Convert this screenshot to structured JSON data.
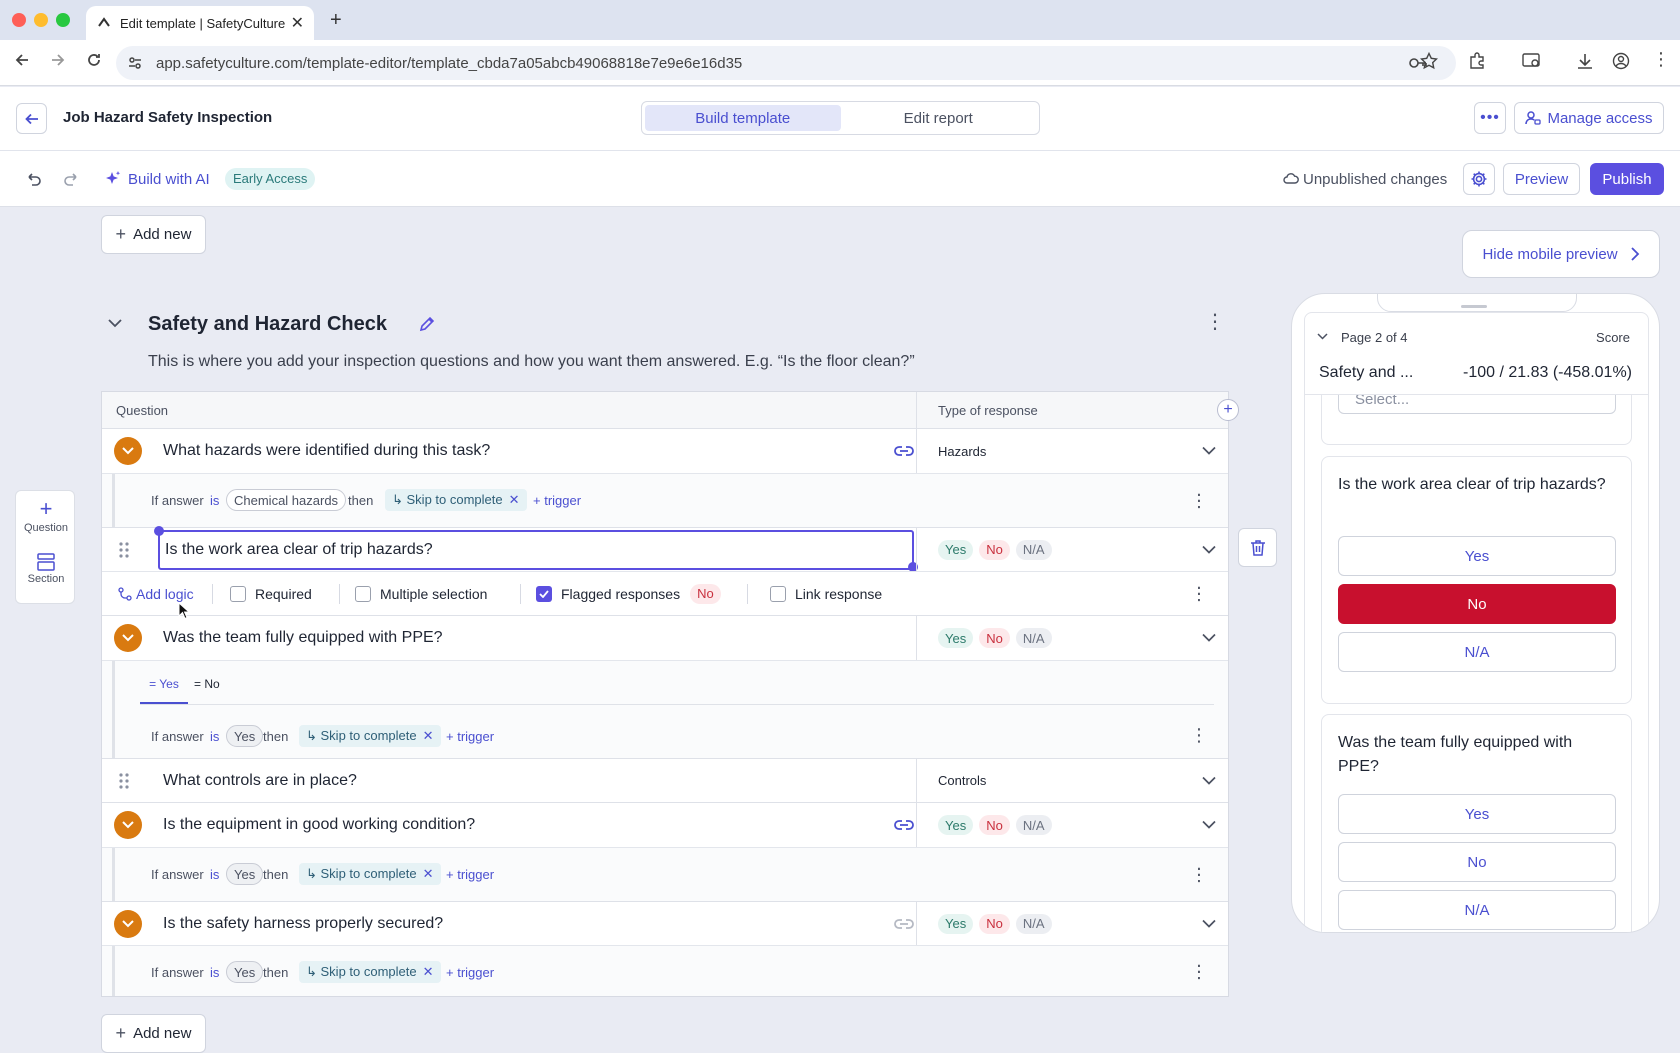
{
  "browser": {
    "tab_title": "Edit template | SafetyCulture",
    "url": "app.safetyculture.com/template-editor/template_cbda7a05abcb49068818e7e9e6e16d35"
  },
  "header": {
    "title": "Job Hazard Safety Inspection",
    "tabs": [
      "Build template",
      "Edit report"
    ],
    "active_tab": "Build template",
    "manage_access": "Manage access"
  },
  "toolbar": {
    "build_ai": "Build with AI",
    "badge": "Early Access",
    "status": "Unpublished changes",
    "preview": "Preview",
    "publish": "Publish"
  },
  "editor": {
    "add_new_top": "Add new",
    "add_new_bottom": "Add new",
    "hide_preview": "Hide mobile preview",
    "section_title": "Safety and Hazard Check",
    "section_desc": "This is where you add your inspection questions and how you want them answered. E.g. “Is the floor clean?”",
    "col_question": "Question",
    "col_response": "Type of response",
    "side_question": "Question",
    "side_section": "Section",
    "q1": {
      "text": "What hazards were identified during this task?",
      "response": "Hazards"
    },
    "logic1": {
      "if": "If answer",
      "is": "is",
      "value": "Chemical hazards",
      "then": "then",
      "action": "↳ Skip to complete",
      "trigger": "+ trigger"
    },
    "q2": {
      "text": "Is the work area clear of trip hazards?"
    },
    "q2_options": {
      "add_logic": "Add logic",
      "required": "Required",
      "multiple": "Multiple selection",
      "flagged": "Flagged responses",
      "flag_value": "No",
      "link": "Link response"
    },
    "q3": {
      "text": "Was the team fully equipped with PPE?"
    },
    "q3_tabs": [
      "= Yes",
      "= No"
    ],
    "logic3": {
      "if": "If answer",
      "is": "is",
      "value": "Yes",
      "then": "then",
      "action": "↳ Skip to complete",
      "trigger": "+ trigger"
    },
    "q4": {
      "text": "What controls are in place?",
      "response": "Controls"
    },
    "q5": {
      "text": "Is the equipment in good working condition?"
    },
    "logic5": {
      "if": "If answer",
      "is": "is",
      "value": "Yes",
      "then": "then",
      "action": "↳ Skip to complete",
      "trigger": "+ trigger"
    },
    "q6": {
      "text": "Is the safety harness properly secured?"
    },
    "logic6": {
      "if": "If answer",
      "is": "is",
      "value": "Yes",
      "then": "then",
      "action": "↳ Skip to complete",
      "trigger": "+ trigger"
    },
    "resp": {
      "yes": "Yes",
      "no": "No",
      "na": "N/A"
    }
  },
  "mobile": {
    "page": "Page 2 of 4",
    "score_label": "Score",
    "section": "Safety and ...",
    "score": "-100 / 21.83 (-458.01%)",
    "select_placeholder": "Select...",
    "q1": "Is the work area clear of trip hazards?",
    "q2": "Was the team fully equipped with PPE?",
    "yes": "Yes",
    "no": "No",
    "na": "N/A"
  },
  "colors": {
    "accent": "#4a4fd0",
    "publish": "#5b4fe0",
    "orange": "#d97a10",
    "no_selected": "#c8102e"
  }
}
